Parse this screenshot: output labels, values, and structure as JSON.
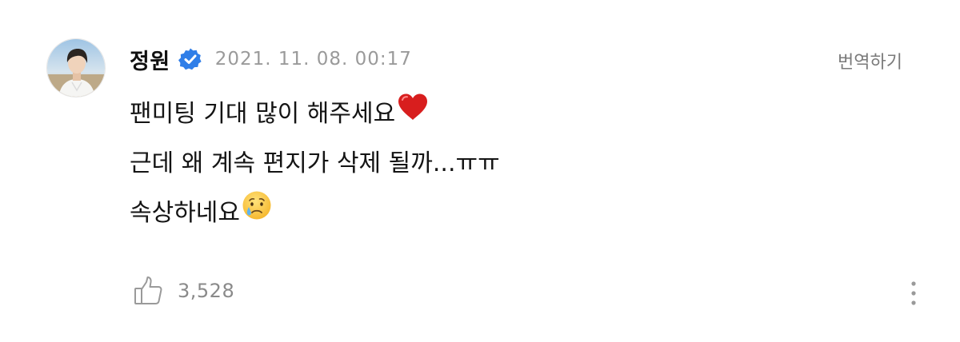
{
  "post": {
    "author_name": "정원",
    "verified": true,
    "timestamp": "2021. 11. 08. 00:17",
    "translate_label": "번역하기",
    "lines": [
      "팬미팅 기대 많이 해주세요",
      "근데 왜 계속 편지가 삭제 될까...ㅠㅠ",
      "속상하네요"
    ],
    "line_emojis": [
      "red-heart-icon",
      "",
      "crying-face-icon"
    ]
  },
  "footer": {
    "like_count": "3,528",
    "like_icon": "thumbs-up-icon",
    "more_icon": "more-vertical-icon"
  },
  "colors": {
    "verified_blue": "#2f7ee8",
    "heart_red": "#d81e1e",
    "meta_gray": "#9a9a9a"
  }
}
